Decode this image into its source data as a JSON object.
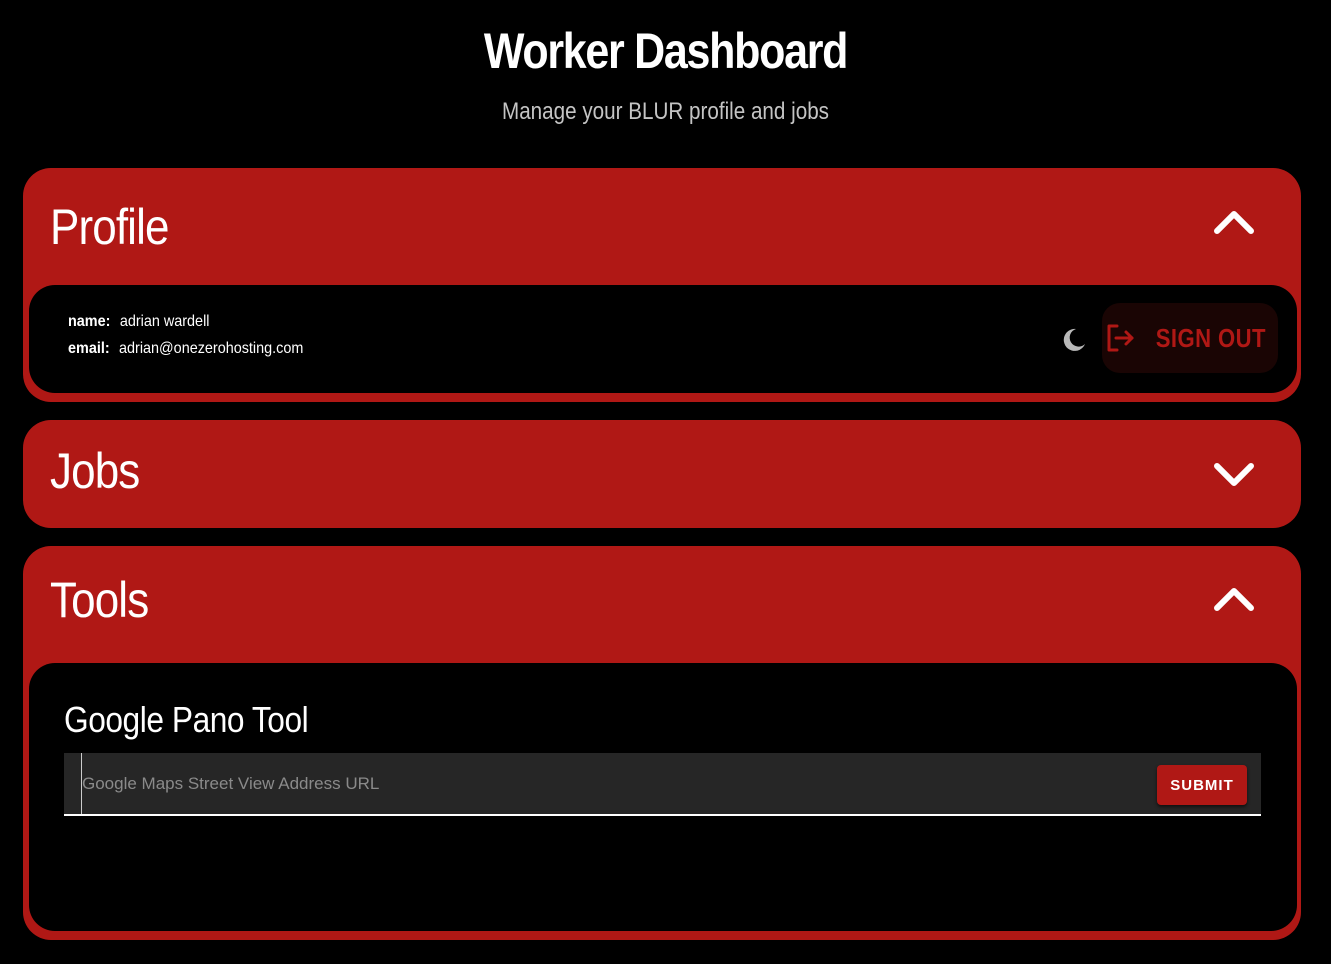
{
  "header": {
    "title": "Worker Dashboard",
    "subtitle": "Manage your BLUR profile and jobs"
  },
  "profile": {
    "title": "Profile",
    "expanded": true,
    "name_label": "name:",
    "name_value": "adrian wardell",
    "email_label": "email:",
    "email_value": "adrian@onezerohosting.com",
    "theme_icon": "moon-icon",
    "signout_label": "SIGN OUT",
    "signout_icon": "logout-icon"
  },
  "jobs": {
    "title": "Jobs",
    "expanded": false
  },
  "tools": {
    "title": "Tools",
    "expanded": true,
    "tool_title": "Google Pano Tool",
    "input_placeholder": "Google Maps Street View Address URL",
    "input_value": "",
    "submit_label": "SUBMIT"
  },
  "colors": {
    "accent": "#b01815",
    "background": "#000000",
    "input_bg": "#262626"
  }
}
